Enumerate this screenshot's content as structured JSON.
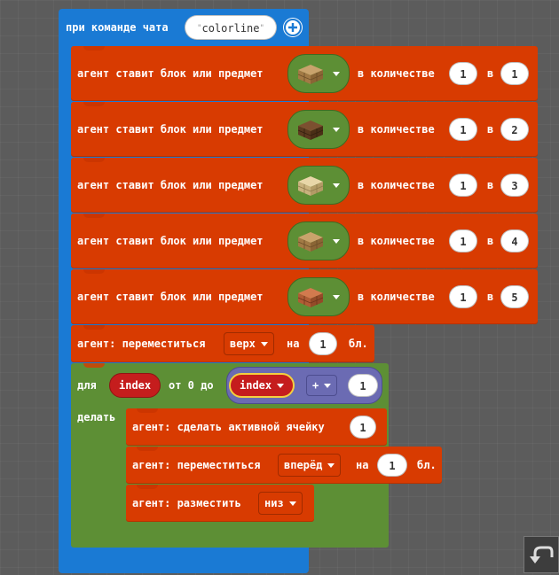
{
  "event": {
    "label": "при команде чата",
    "command_value": "colorline"
  },
  "place_rows": [
    {
      "label": "агент ставит блок или предмет",
      "item_icon": "planks-block-icon",
      "item_color": "#b8905a",
      "qty_label": "в количестве",
      "quantity": "1",
      "slot_label": "в",
      "slot": "1"
    },
    {
      "label": "агент ставит блок или предмет",
      "item_icon": "dark-planks-block-icon",
      "item_color": "#6b4223",
      "qty_label": "в количестве",
      "quantity": "1",
      "slot_label": "в",
      "slot": "2"
    },
    {
      "label": "агент ставит блок или предмет",
      "item_icon": "birch-planks-block-icon",
      "item_color": "#dcc79a",
      "qty_label": "в количестве",
      "quantity": "1",
      "slot_label": "в",
      "slot": "3"
    },
    {
      "label": "агент ставит блок или предмет",
      "item_icon": "planks-block-icon",
      "item_color": "#b8905a",
      "qty_label": "в количестве",
      "quantity": "1",
      "slot_label": "в",
      "slot": "4"
    },
    {
      "label": "агент ставит блок или предмет",
      "item_icon": "acacia-planks-block-icon",
      "item_color": "#b8613a",
      "qty_label": "в количестве",
      "quantity": "1",
      "slot_label": "в",
      "slot": "5"
    }
  ],
  "move_up": {
    "label": "агент: переместиться",
    "direction": "верх",
    "on_label": "на",
    "amount": "1",
    "unit": "бл."
  },
  "loop": {
    "for_label": "для",
    "var_name": "index",
    "from_label": "от 0 до",
    "expr_var": "index",
    "operator": "+",
    "operand": "1",
    "do_label": "делать"
  },
  "loop_body": {
    "active_slot_label": "агент: сделать активной ячейку",
    "active_slot_value": "1",
    "move_label": "агент: переместиться",
    "move_direction": "вперёд",
    "move_on_label": "на",
    "move_amount": "1",
    "move_unit": "бл.",
    "place_label": "агент: разместить",
    "place_direction": "низ"
  },
  "colors": {
    "event_block": "#1a7ad4",
    "agent_block": "#d83b01",
    "loop_block": "#5d8f35",
    "variable": "#c51d1d",
    "math": "#6b6bb3",
    "workspace": "#5c5c5c"
  },
  "undo_icon": "undo-icon"
}
